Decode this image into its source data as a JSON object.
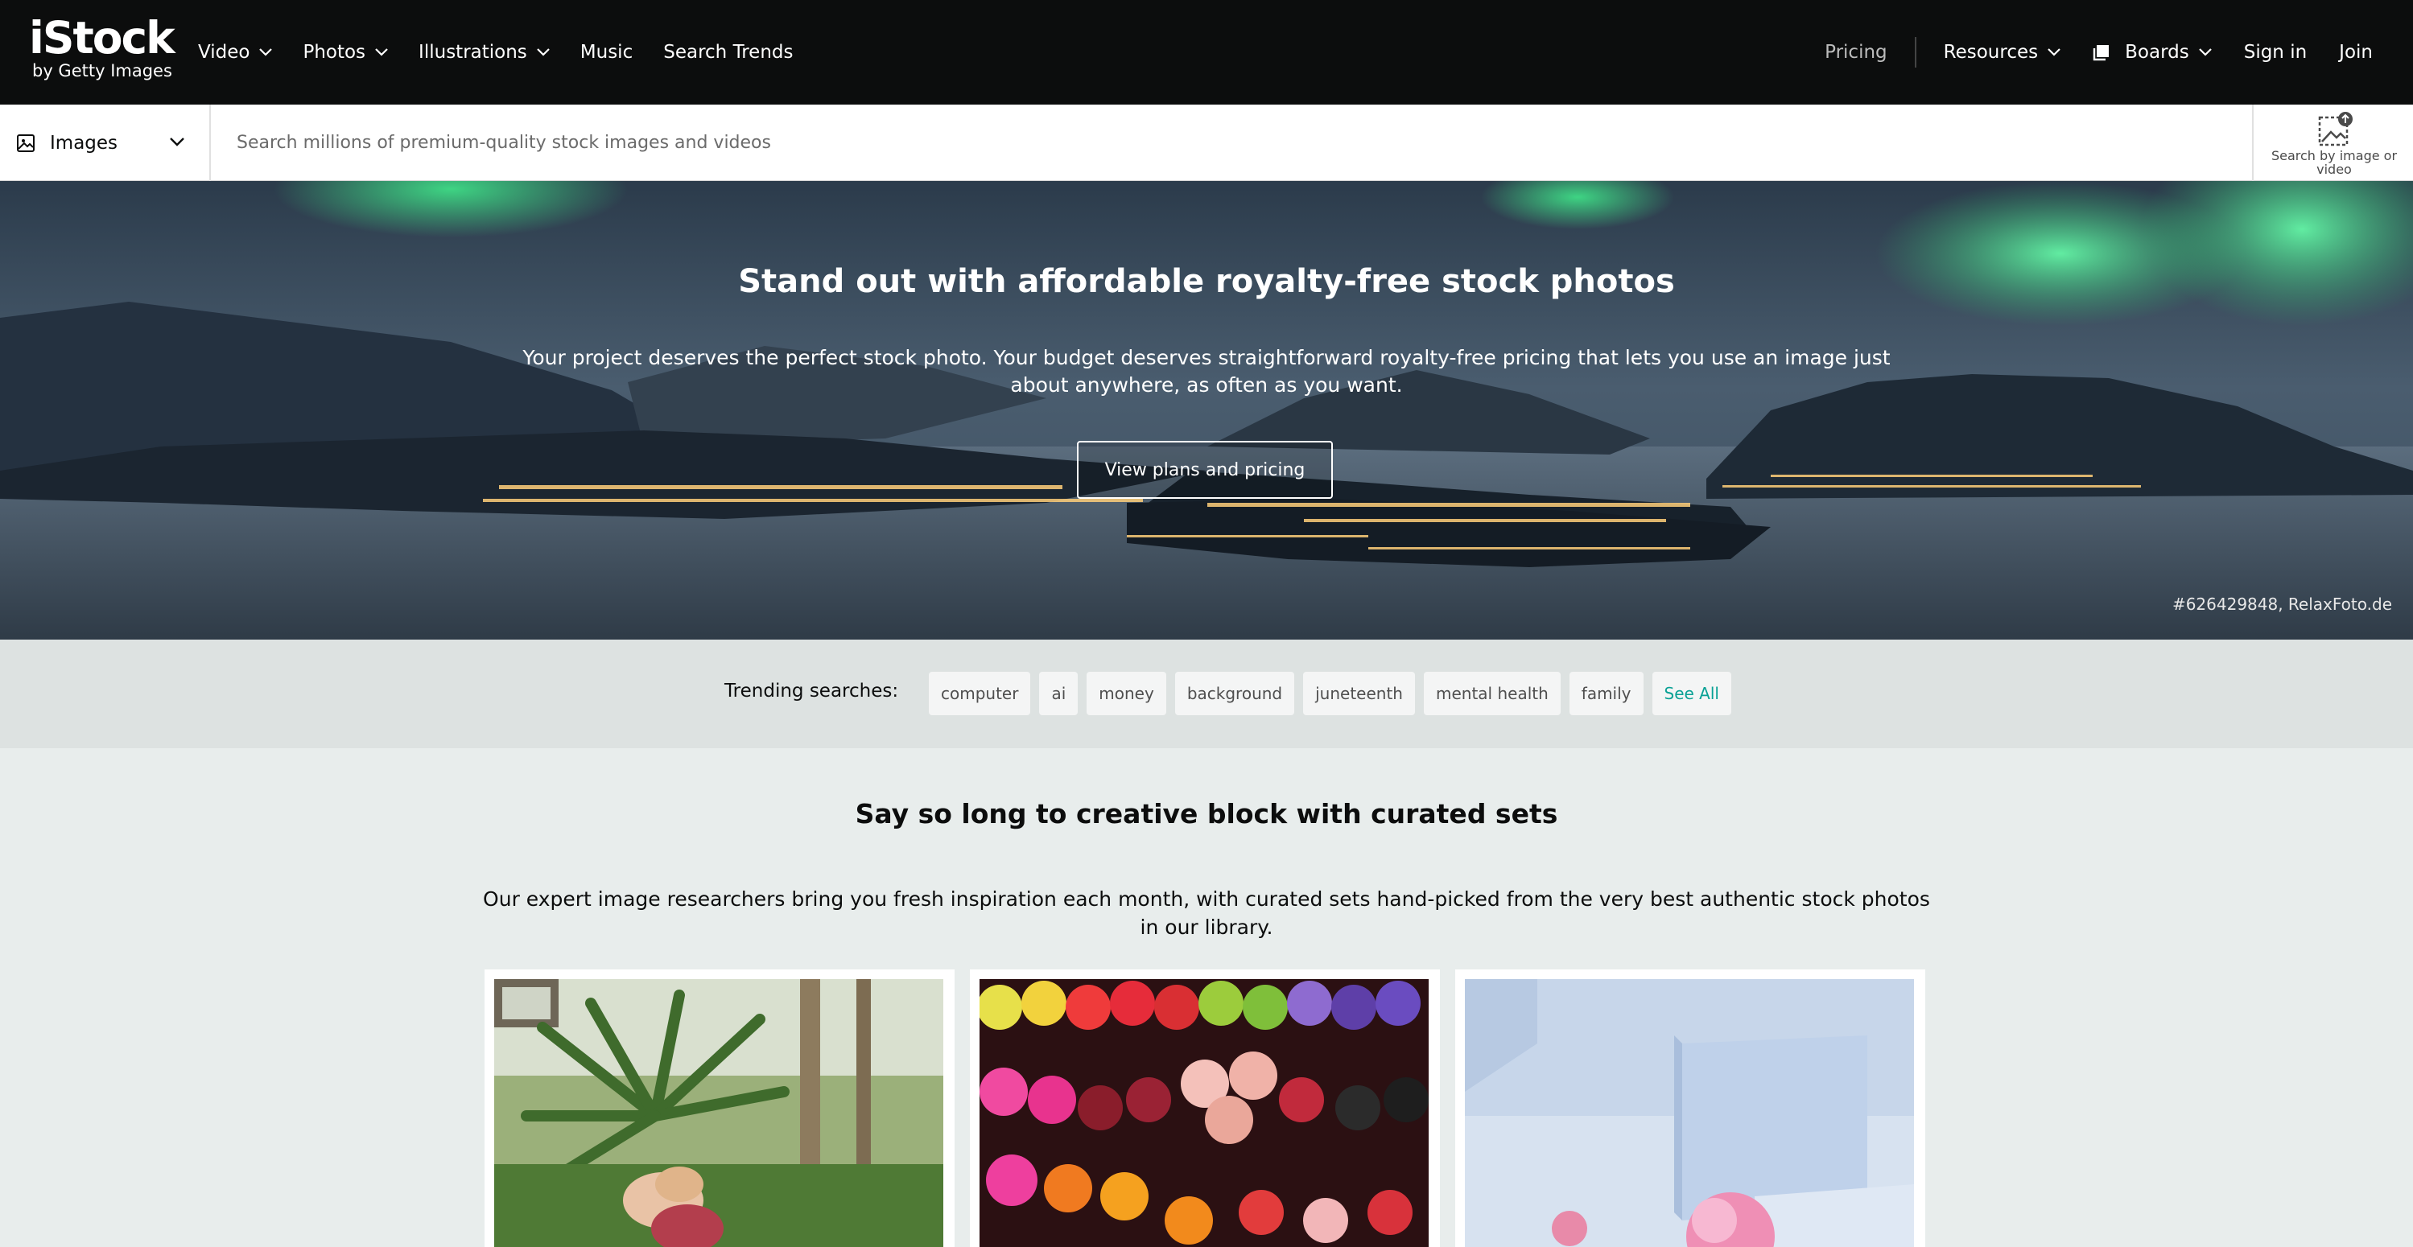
{
  "logo": {
    "main": "iStock",
    "sub": "by Getty Images"
  },
  "nav": {
    "left": [
      {
        "label": "Video",
        "dropdown": true
      },
      {
        "label": "Photos",
        "dropdown": true
      },
      {
        "label": "Illustrations",
        "dropdown": true
      },
      {
        "label": "Music",
        "dropdown": false
      },
      {
        "label": "Search Trends",
        "dropdown": false
      }
    ],
    "pricing": "Pricing",
    "resources": "Resources",
    "boards": "Boards",
    "sign_in": "Sign in",
    "join": "Join"
  },
  "search": {
    "type_label": "Images",
    "placeholder": "Search millions of premium-quality stock images and videos",
    "by_image_label": "Search by image or video"
  },
  "hero": {
    "title": "Stand out with affordable royalty-free stock photos",
    "description": "Your project deserves the perfect stock photo. Your budget deserves straightforward royalty-free pricing that lets you use an image just about anywhere, as often as you want.",
    "button": "View plans and pricing",
    "credit": "#626429848, RelaxFoto.de"
  },
  "trending": {
    "label": "Trending searches:",
    "chips": [
      "computer",
      "ai",
      "money",
      "background",
      "juneteenth",
      "mental health",
      "family"
    ],
    "see_all": "See All"
  },
  "curated": {
    "title": "Say so long to creative block with curated sets",
    "description": "Our expert image researchers bring you fresh inspiration each month, with curated sets hand-picked from the very best authentic stock photos in our library."
  },
  "colors": {
    "topbar": "#0c0d0d",
    "accent": "#08a195",
    "page_bg": "#e8edec",
    "trending_bg": "#dde2e1"
  }
}
